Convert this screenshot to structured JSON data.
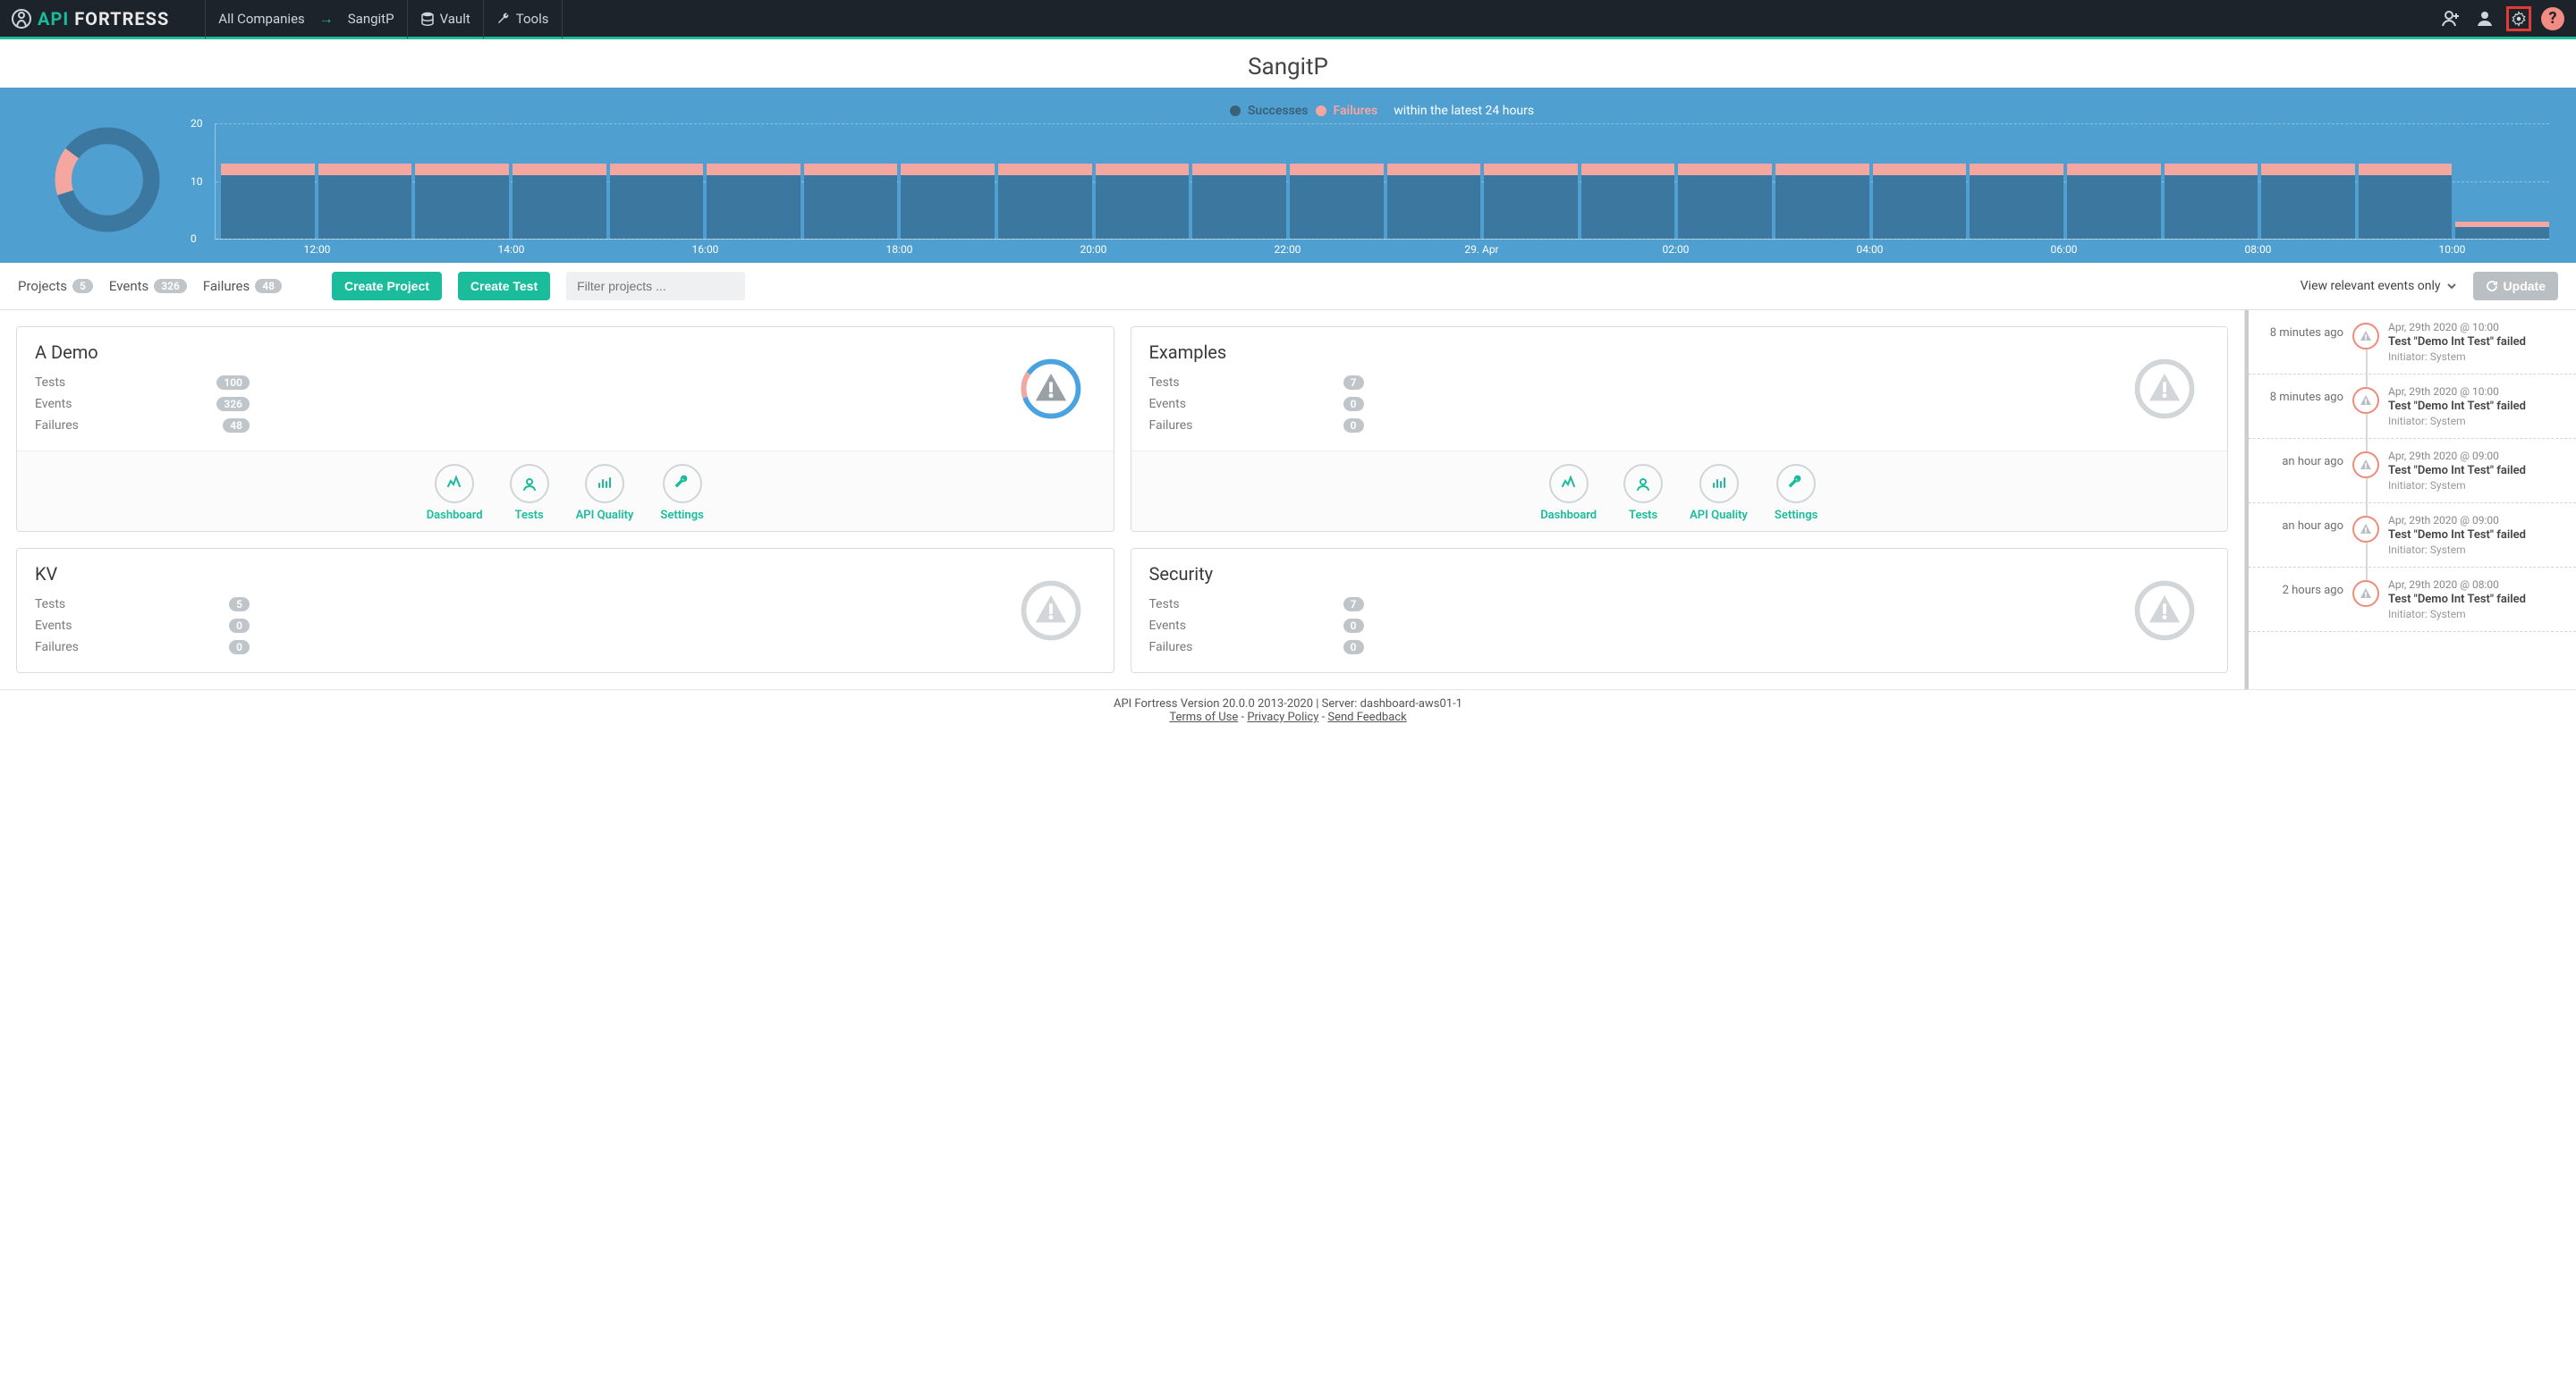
{
  "brand": {
    "api": "API",
    "fortress": "FORTRESS"
  },
  "nav": {
    "all_companies": "All Companies",
    "company": "SangitP",
    "vault": "Vault",
    "tools": "Tools"
  },
  "page_title": "SangitP",
  "legend": {
    "successes": "Successes",
    "failures": "Failures",
    "period": "within the latest 24 hours"
  },
  "chart_data": {
    "type": "bar",
    "y_ticks": [
      0,
      10,
      20
    ],
    "ylim": [
      0,
      20
    ],
    "x_ticks": [
      "12:00",
      "14:00",
      "16:00",
      "18:00",
      "20:00",
      "22:00",
      "29. Apr",
      "02:00",
      "04:00",
      "06:00",
      "08:00",
      "10:00"
    ],
    "series": [
      {
        "name": "Successes",
        "color": "#3c77a0",
        "values": [
          11,
          11,
          11,
          11,
          11,
          11,
          11,
          11,
          11,
          11,
          11,
          11,
          11,
          11,
          11,
          11,
          11,
          11,
          11,
          11,
          11,
          11,
          11,
          2
        ]
      },
      {
        "name": "Failures",
        "color": "#f4a6a0",
        "values": [
          2,
          2,
          2,
          2,
          2,
          2,
          2,
          2,
          2,
          2,
          2,
          2,
          2,
          2,
          2,
          2,
          2,
          2,
          2,
          2,
          2,
          2,
          2,
          1
        ]
      }
    ],
    "donut": {
      "successes_pct": 85,
      "failures_pct": 15
    }
  },
  "tabs": {
    "projects_label": "Projects",
    "projects_count": "5",
    "events_label": "Events",
    "events_count": "326",
    "failures_label": "Failures",
    "failures_count": "48"
  },
  "toolbar": {
    "create_project": "Create Project",
    "create_test": "Create Test",
    "filter_placeholder": "Filter projects ...",
    "view_events": "View relevant events only",
    "update": "Update"
  },
  "projects": [
    {
      "name": "A Demo",
      "tests": "100",
      "events": "326",
      "failures": "48",
      "ring": "active"
    },
    {
      "name": "Examples",
      "tests": "7",
      "events": "0",
      "failures": "0",
      "ring": "idle"
    },
    {
      "name": "KV",
      "tests": "5",
      "events": "0",
      "failures": "0",
      "ring": "idle"
    },
    {
      "name": "Security",
      "tests": "7",
      "events": "0",
      "failures": "0",
      "ring": "idle"
    }
  ],
  "project_labels": {
    "tests": "Tests",
    "events": "Events",
    "failures": "Failures",
    "dashboard": "Dashboard",
    "tests_action": "Tests",
    "api_quality": "API Quality",
    "settings": "Settings"
  },
  "events": [
    {
      "ago": "8 minutes ago",
      "date": "Apr, 29th 2020 @ 10:00",
      "msg": "Test \"Demo Int Test\" failed",
      "initiator": "Initiator: System"
    },
    {
      "ago": "8 minutes ago",
      "date": "Apr, 29th 2020 @ 10:00",
      "msg": "Test \"Demo Int Test\" failed",
      "initiator": "Initiator: System"
    },
    {
      "ago": "an hour ago",
      "date": "Apr, 29th 2020 @ 09:00",
      "msg": "Test \"Demo Int Test\" failed",
      "initiator": "Initiator: System"
    },
    {
      "ago": "an hour ago",
      "date": "Apr, 29th 2020 @ 09:00",
      "msg": "Test \"Demo Int Test\" failed",
      "initiator": "Initiator: System"
    },
    {
      "ago": "2 hours ago",
      "date": "Apr, 29th 2020 @ 08:00",
      "msg": "Test \"Demo Int Test\" failed",
      "initiator": "Initiator: System"
    }
  ],
  "footer": {
    "version": "API Fortress Version 20.0.0 2013-2020 | Server: dashboard-aws01-1",
    "terms": "Terms of Use",
    "privacy": "Privacy Policy",
    "feedback": "Send Feedback"
  }
}
